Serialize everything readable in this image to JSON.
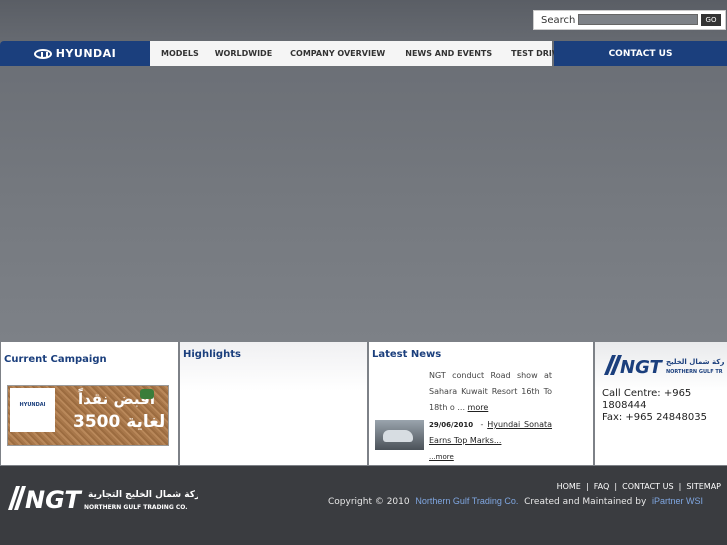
{
  "search": {
    "label": "Search",
    "go_label": "GO"
  },
  "nav": {
    "brand": "HYUNDAI",
    "items": [
      "MODELS",
      "WORLDWIDE",
      "COMPANY OVERVIEW",
      "NEWS AND EVENTS",
      "TEST DRIVE"
    ],
    "contact": "CONTACT US"
  },
  "panels": {
    "campaign": {
      "title": "Current Campaign",
      "banner_brand": "HYUNDAI",
      "banner_arabic": "اقبض نقداً",
      "banner_amount": "3500 لغاية"
    },
    "highlights": {
      "title": "Highlights"
    },
    "news": {
      "title": "Latest News",
      "item1_text": "NGT conduct Road show at Sahara Kuwait Resort 16th To 18th o ...",
      "item1_more": "more",
      "item2_date": "29/06/2010",
      "item2_link": "Hyundai Sonata Earns Top Marks...",
      "item2_more": "...more"
    },
    "contact": {
      "call": "Call Centre: +965 1808444",
      "fax": "Fax: +965 24848035"
    }
  },
  "footer": {
    "links": [
      "HOME",
      "FAQ",
      "CONTACT US",
      "SITEMAP"
    ],
    "copyright_prefix": "Copyright © 2010",
    "company": "Northern Gulf Trading Co.",
    "maintained": "Created and Maintained by",
    "partner": "iPartner WSI",
    "logo_text": "NGT",
    "logo_arabic": "شركة شمال الخليج التجارية",
    "logo_english": "NORTHERN GULF TRADING CO."
  },
  "colors": {
    "brand_blue": "#1b3f7d",
    "footer": "#3a3c40"
  }
}
